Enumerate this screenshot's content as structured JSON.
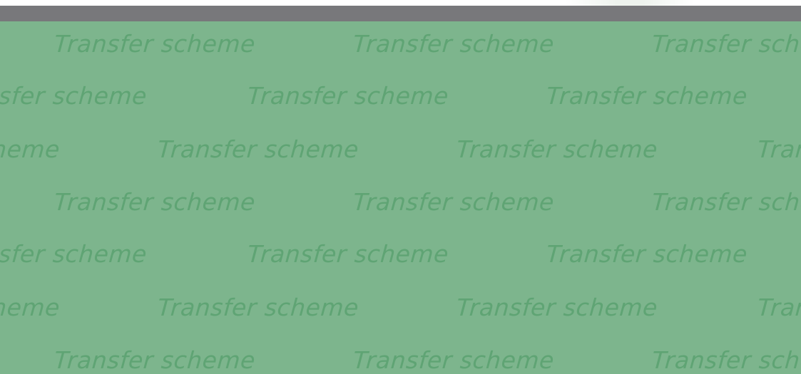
{
  "watermark": {
    "text": "Transfer scheme"
  },
  "colors": {
    "panel_background": "#7db58d",
    "watermark_text": "#5fa474",
    "top_bar": "#78787b"
  }
}
